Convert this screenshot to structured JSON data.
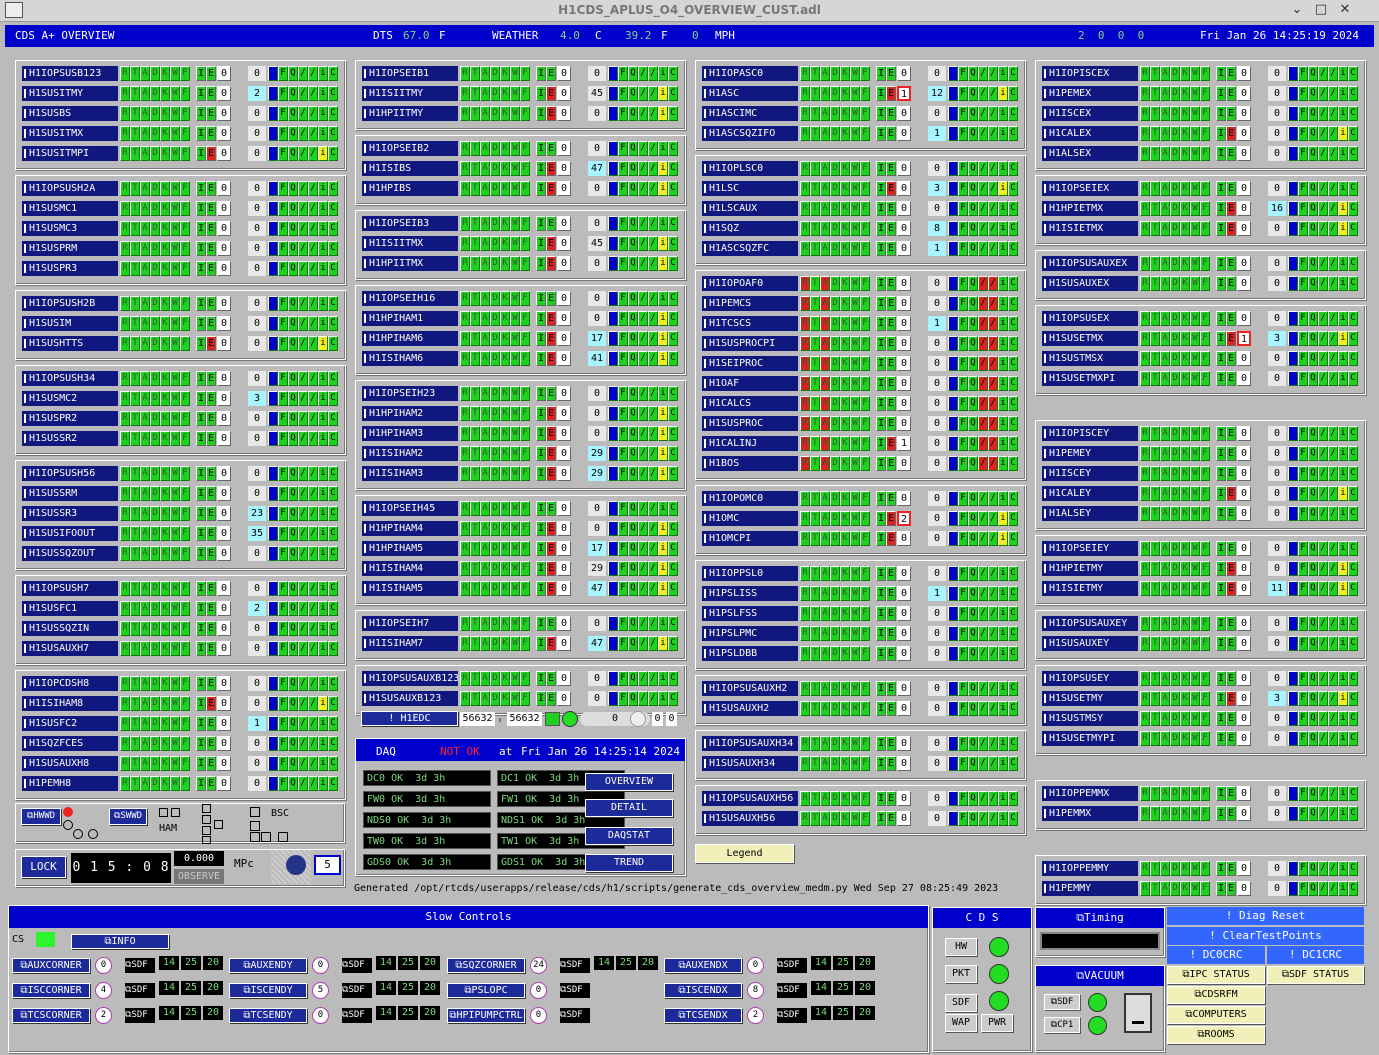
{
  "window": {
    "title": "H1CDS_APLUS_O4_OVERVIEW_CUST.adl"
  },
  "top": {
    "title": "CDS A+ OVERVIEW",
    "dts_label": "DTS",
    "dts_value": "67.0",
    "dts_unit": "F",
    "weather_label": "WEATHER",
    "w_c": "4.0",
    "w_c_unit": "C",
    "w_f": "39.2",
    "w_f_unit": "F",
    "w_mph": "0",
    "w_mph_unit": "MPH",
    "counts": "2  0  0  0",
    "datetime": "Fri Jan 26 14:25:19 2024"
  },
  "state_letters": [
    "R",
    "T",
    "A",
    "D",
    "K",
    "W",
    "F"
  ],
  "columns": [
    {
      "groups": [
        {
          "rows": [
            {
              "name": "H1IOPSUSB123",
              "cnt": "0"
            },
            {
              "name": "H1SUSITMY",
              "cnt": "2",
              "c": 1
            },
            {
              "name": "H1SUSBS",
              "cnt": "0"
            },
            {
              "name": "H1SUSITMX",
              "cnt": "0"
            },
            {
              "name": "H1SUSITMPI",
              "cnt": "0",
              "e": 1,
              "y": 1
            }
          ]
        },
        {
          "rows": [
            {
              "name": "H1IOPSUSH2A",
              "cnt": "0"
            },
            {
              "name": "H1SUSMC1",
              "cnt": "0"
            },
            {
              "name": "H1SUSMC3",
              "cnt": "0"
            },
            {
              "name": "H1SUSPRM",
              "cnt": "0"
            },
            {
              "name": "H1SUSPR3",
              "cnt": "0"
            }
          ]
        },
        {
          "rows": [
            {
              "name": "H1IOPSUSH2B",
              "cnt": "0"
            },
            {
              "name": "H1SUSIM",
              "cnt": "0"
            },
            {
              "name": "H1SUSHTTS",
              "cnt": "0",
              "e": 1,
              "y": 1
            }
          ]
        },
        {
          "rows": [
            {
              "name": "H1IOPSUSH34",
              "cnt": "0"
            },
            {
              "name": "H1SUSMC2",
              "cnt": "3",
              "c": 1
            },
            {
              "name": "H1SUSPR2",
              "cnt": "0"
            },
            {
              "name": "H1SUSSR2",
              "cnt": "0"
            }
          ]
        },
        {
          "rows": [
            {
              "name": "H1IOPSUSH56",
              "cnt": "0"
            },
            {
              "name": "H1SUSSRM",
              "cnt": "0"
            },
            {
              "name": "H1SUSSR3",
              "cnt": "23",
              "c": 1
            },
            {
              "name": "H1SUSIFOOUT",
              "cnt": "35",
              "c": 1
            },
            {
              "name": "H1SUSSQZOUT",
              "cnt": "0"
            }
          ]
        },
        {
          "rows": [
            {
              "name": "H1IOPSUSH7",
              "cnt": "0"
            },
            {
              "name": "H1SUSFC1",
              "cnt": "2",
              "c": 1
            },
            {
              "name": "H1SUSSQZIN",
              "cnt": "0"
            },
            {
              "name": "H1SUSAUXH7",
              "cnt": "0"
            }
          ]
        },
        {
          "rows": [
            {
              "name": "H1IOPCDSH8",
              "cnt": "0"
            },
            {
              "name": "H1ISIHAM8",
              "cnt": "0",
              "e": 1,
              "y": 1
            },
            {
              "name": "H1SUSFC2",
              "cnt": "1",
              "c": 1
            },
            {
              "name": "H1SQZFCES",
              "cnt": "0"
            },
            {
              "name": "H1SUSAUXH8",
              "cnt": "0"
            },
            {
              "name": "H1PEMH8",
              "cnt": "0"
            }
          ]
        }
      ]
    },
    {
      "groups": [
        {
          "rows": [
            {
              "name": "H1IOPSEIB1",
              "cnt": "0"
            },
            {
              "name": "H1ISIITMY",
              "cnt": "45",
              "e": 1,
              "y": 1
            },
            {
              "name": "H1HPIITMY",
              "cnt": "0",
              "e": 1,
              "y": 1
            }
          ]
        },
        {
          "rows": [
            {
              "name": "H1IOPSEIB2",
              "cnt": "0"
            },
            {
              "name": "H1ISIBS",
              "cnt": "47",
              "c": 1,
              "e": 1,
              "y": 1
            },
            {
              "name": "H1HPIBS",
              "cnt": "0",
              "e": 1,
              "y": 1
            }
          ]
        },
        {
          "rows": [
            {
              "name": "H1IOPSEIB3",
              "cnt": "0"
            },
            {
              "name": "H1ISIITMX",
              "cnt": "45",
              "e": 1,
              "y": 1
            },
            {
              "name": "H1HPIITMX",
              "cnt": "0",
              "e": 1,
              "y": 1
            }
          ]
        },
        {
          "rows": [
            {
              "name": "H1IOPSEIH16",
              "cnt": "0"
            },
            {
              "name": "H1HPIHAM1",
              "cnt": "0",
              "e": 1,
              "y": 1
            },
            {
              "name": "H1HPIHAM6",
              "cnt": "17",
              "c": 1,
              "e": 1,
              "y": 1
            },
            {
              "name": "H1ISIHAM6",
              "cnt": "41",
              "c": 1,
              "e": 1,
              "y": 1
            }
          ]
        },
        {
          "rows": [
            {
              "name": "H1IOPSEIH23",
              "cnt": "0"
            },
            {
              "name": "H1HPIHAM2",
              "cnt": "0",
              "e": 1,
              "y": 1
            },
            {
              "name": "H1HPIHAM3",
              "cnt": "0",
              "e": 1,
              "y": 1
            },
            {
              "name": "H1ISIHAM2",
              "cnt": "29",
              "c": 1,
              "e": 1,
              "y": 1
            },
            {
              "name": "H1ISIHAM3",
              "cnt": "29",
              "c": 1,
              "e": 1,
              "y": 1
            }
          ]
        },
        {
          "rows": [
            {
              "name": "H1IOPSEIH45",
              "cnt": "0"
            },
            {
              "name": "H1HPIHAM4",
              "cnt": "0",
              "e": 1,
              "y": 1
            },
            {
              "name": "H1HPIHAM5",
              "cnt": "17",
              "c": 1,
              "e": 1,
              "y": 1
            },
            {
              "name": "H1ISIHAM4",
              "cnt": "29",
              "e": 1,
              "y": 1
            },
            {
              "name": "H1ISIHAM5",
              "cnt": "47",
              "c": 1,
              "e": 1,
              "y": 1
            }
          ]
        },
        {
          "rows": [
            {
              "name": "H1IOPSEIH7",
              "cnt": "0"
            },
            {
              "name": "H1ISIHAM7",
              "cnt": "47",
              "c": 1,
              "e": 1,
              "y": 1
            }
          ]
        },
        {
          "rows": [
            {
              "name": "H1IOPSUSAUXB123",
              "cnt": "0"
            },
            {
              "name": "H1SUSAUXB123",
              "cnt": "0"
            }
          ]
        }
      ]
    },
    {
      "groups": [
        {
          "rows": [
            {
              "name": "H1IOPASC0",
              "cnt": "0"
            },
            {
              "name": "H1ASC",
              "cnt": "12",
              "c": 1,
              "e": 1,
              "v": "1",
              "vr": 1,
              "y": 1
            },
            {
              "name": "H1ASCIMC",
              "cnt": "0"
            },
            {
              "name": "H1ASCSQZIFO",
              "cnt": "1",
              "c": 1
            }
          ]
        },
        {
          "rows": [
            {
              "name": "H1IOPLSC0",
              "cnt": "0"
            },
            {
              "name": "H1LSC",
              "cnt": "3",
              "c": 1,
              "e": 1,
              "y": 1
            },
            {
              "name": "H1LSCAUX",
              "cnt": "0"
            },
            {
              "name": "H1SQZ",
              "cnt": "8",
              "c": 1
            },
            {
              "name": "H1ASCSQZFC",
              "cnt": "1",
              "c": 1
            }
          ]
        },
        {
          "rows": [
            {
              "name": "H1IOPOAF0",
              "cnt": "0",
              "rt": 1,
              "x": 1
            },
            {
              "name": "H1PEMCS",
              "cnt": "0",
              "rt": 1,
              "x": 1
            },
            {
              "name": "H1TCSCS",
              "cnt": "1",
              "c": 1,
              "rt": 1,
              "x": 1
            },
            {
              "name": "H1SUSPROCPI",
              "cnt": "0",
              "rt": 1,
              "x": 1
            },
            {
              "name": "H1SEIPROC",
              "cnt": "0",
              "rt": 1,
              "x": 1
            },
            {
              "name": "H1OAF",
              "cnt": "0",
              "rt": 1,
              "x": 1
            },
            {
              "name": "H1CALCS",
              "cnt": "0",
              "rt": 1,
              "x": 1
            },
            {
              "name": "H1SUSPROC",
              "cnt": "0",
              "rt": 1,
              "x": 1
            },
            {
              "name": "H1CALINJ",
              "cnt": "0",
              "rt": 1,
              "x": 1,
              "e": 1,
              "v": "1"
            },
            {
              "name": "H1BOS",
              "cnt": "0",
              "rt": 1,
              "x": 1
            }
          ]
        },
        {
          "rows": [
            {
              "name": "H1IOPOMC0",
              "cnt": "0"
            },
            {
              "name": "H1OMC",
              "cnt": "0",
              "e": 1,
              "v": "2",
              "vr": 1,
              "y": 1
            },
            {
              "name": "H1OMCPI",
              "cnt": "0",
              "e": 1,
              "y": 1
            }
          ]
        },
        {
          "rows": [
            {
              "name": "H1IOPPSL0",
              "cnt": "0"
            },
            {
              "name": "H1PSLISS",
              "cnt": "1",
              "c": 1
            },
            {
              "name": "H1PSLFSS",
              "cnt": "0"
            },
            {
              "name": "H1PSLPMC",
              "cnt": "0"
            },
            {
              "name": "H1PSLDBB",
              "cnt": "0"
            }
          ]
        },
        {
          "rows": [
            {
              "name": "H1IOPSUSAUXH2",
              "cnt": "0"
            },
            {
              "name": "H1SUSAUXH2",
              "cnt": "0"
            }
          ]
        },
        {
          "rows": [
            {
              "name": "H1IOPSUSAUXH34",
              "cnt": "0"
            },
            {
              "name": "H1SUSAUXH34",
              "cnt": "0"
            }
          ]
        },
        {
          "rows": [
            {
              "name": "H1IOPSUSAUXH56",
              "cnt": "0"
            },
            {
              "name": "H1SUSAUXH56",
              "cnt": "0"
            }
          ]
        }
      ]
    },
    {
      "groups": [
        {
          "rows": [
            {
              "name": "H1IOPISCEX",
              "cnt": "0"
            },
            {
              "name": "H1PEMEX",
              "cnt": "0"
            },
            {
              "name": "H1ISCEX",
              "cnt": "0"
            },
            {
              "name": "H1CALEX",
              "cnt": "0",
              "e": 1,
              "y": 1
            },
            {
              "name": "H1ALSEX",
              "cnt": "0"
            }
          ]
        },
        {
          "rows": [
            {
              "name": "H1IOPSEIEX",
              "cnt": "0"
            },
            {
              "name": "H1HPIETMX",
              "cnt": "16",
              "c": 1,
              "e": 1,
              "y": 1
            },
            {
              "name": "H1ISIETMX",
              "cnt": "0",
              "e": 1,
              "y": 1
            }
          ]
        },
        {
          "rows": [
            {
              "name": "H1IOPSUSAUXEX",
              "cnt": "0"
            },
            {
              "name": "H1SUSAUXEX",
              "cnt": "0"
            }
          ]
        },
        {
          "rows": [
            {
              "name": "H1IOPSUSEX",
              "cnt": "0"
            },
            {
              "name": "H1SUSETMX",
              "cnt": "3",
              "c": 1,
              "e": 1,
              "v": "1",
              "vr": 1,
              "y": 1
            },
            {
              "name": "H1SUSTMSX",
              "cnt": "0"
            },
            {
              "name": "H1SUSETMXPI",
              "cnt": "0"
            }
          ]
        },
        {
          "rows": [
            {
              "name": "H1IOPISCEY",
              "cnt": "0"
            },
            {
              "name": "H1PEMEY",
              "cnt": "0"
            },
            {
              "name": "H1ISCEY",
              "cnt": "0"
            },
            {
              "name": "H1CALEY",
              "cnt": "0",
              "e": 1,
              "y": 1
            },
            {
              "name": "H1ALSEY",
              "cnt": "0"
            }
          ]
        },
        {
          "rows": [
            {
              "name": "H1IOPSEIEY",
              "cnt": "0"
            },
            {
              "name": "H1HPIETMY",
              "cnt": "0",
              "e": 1,
              "y": 1
            },
            {
              "name": "H1ISIETMY",
              "cnt": "11",
              "c": 1,
              "e": 1,
              "y": 1
            }
          ]
        },
        {
          "rows": [
            {
              "name": "H1IOPSUSAUXEY",
              "cnt": "0"
            },
            {
              "name": "H1SUSAUXEY",
              "cnt": "0"
            }
          ]
        },
        {
          "rows": [
            {
              "name": "H1IOPSUSEY",
              "cnt": "0"
            },
            {
              "name": "H1SUSETMY",
              "cnt": "3",
              "c": 1,
              "e": 1,
              "y": 1
            },
            {
              "name": "H1SUSTMSY",
              "cnt": "0"
            },
            {
              "name": "H1SUSETMYPI",
              "cnt": "0"
            }
          ]
        },
        {
          "rows": [
            {
              "name": "H1IOPPEMMX",
              "cnt": "0"
            },
            {
              "name": "H1PEMMX",
              "cnt": "0"
            }
          ]
        },
        {
          "rows": [
            {
              "name": "H1IOPPEMMY",
              "cnt": "0"
            },
            {
              "name": "H1PEMMY",
              "cnt": "0"
            }
          ]
        }
      ]
    }
  ],
  "edc": {
    "label": "! H1EDC",
    "v1": "56632",
    "v2": "56632",
    "v3": "0",
    "v4": "0",
    "v5": "0"
  },
  "daq": {
    "label": "DAQ",
    "status": "NOT OK",
    "at": "at",
    "time": "Fri Jan 26 14:25:14 2024",
    "cells": [
      [
        "DC0 OK  3d 3h",
        "DC1 OK  3d 3h"
      ],
      [
        "FW0 OK  3d 3h",
        "FW1 OK  3d 3h"
      ],
      [
        "NDS0 OK  3d 3h",
        "NDS1 OK  3d 3h"
      ],
      [
        "TW0 OK  3d 3h",
        "TW1 OK  3d 3h"
      ],
      [
        "GDS0 OK  3d 3h",
        "GDS1 OK  3d 3h"
      ]
    ],
    "buttons": [
      "OVERVIEW",
      "DETAIL",
      "DAQSTAT",
      "TREND"
    ]
  },
  "legend": "Legend",
  "hwwd": {
    "hwwd": "HWWD",
    "swwd": "SWWD",
    "ham": "HAM",
    "bsc": "BSC"
  },
  "lock": {
    "label": "LOCK",
    "time": "0 1 5 : 0 8",
    "value": "0.000",
    "observe": "OBSERVE",
    "mpc": "MPc",
    "count": "5"
  },
  "generated": "Generated /opt/rtcds/userapps/release/cds/h1/scripts/generate_cds_overview_medm.py Wed Sep 27 08:25:49 2023",
  "slow": {
    "title": "Slow Controls",
    "cs": "CS",
    "info": "INFO",
    "rows": [
      [
        {
          "l": "AUXCORNER",
          "n": "0"
        },
        {
          "l": "AUXENDY",
          "n": "0"
        },
        {
          "l": "SQZCORNER",
          "n": "24",
          "sq": 1
        },
        {
          "l": "AUXENDX",
          "n": "0"
        }
      ],
      [
        {
          "l": "ISCCORNER",
          "n": "4"
        },
        {
          "l": "ISCENDY",
          "n": "5"
        },
        {
          "l": "PSLOPC",
          "n": "0"
        },
        {
          "l": "ISCENDX",
          "n": "8"
        }
      ],
      [
        {
          "l": "TCSCORNER",
          "n": "2"
        },
        {
          "l": "TCSENDY",
          "n": "0"
        },
        {
          "l": "HPIPUMPCTRL",
          "n": "0"
        },
        {
          "l": "TCSENDX",
          "n": "2"
        }
      ]
    ],
    "sdf": "SDF",
    "nums": [
      "14",
      "25",
      "20"
    ]
  },
  "cds": {
    "title": "C D S",
    "hw": "HW",
    "pkt": "PKT",
    "sdf": "SDF",
    "wap": "WAP",
    "pwr": "PWR"
  },
  "timing": {
    "label": "Timing"
  },
  "vacuum": {
    "label": "VACUUM",
    "sdf": "SDF",
    "cp1": "CP1"
  },
  "right_buttons": {
    "diag_reset": "! Diag Reset",
    "clear_tp": "! ClearTestPoints",
    "dcocrc": "! DC0CRC",
    "dc1crc": "! DC1CRC",
    "ipc": "IPC STATUS",
    "sdfst": "SDF STATUS",
    "cdsrfm": "CDSRFM",
    "computers": "COMPUTERS",
    "rooms": "ROOMS"
  }
}
